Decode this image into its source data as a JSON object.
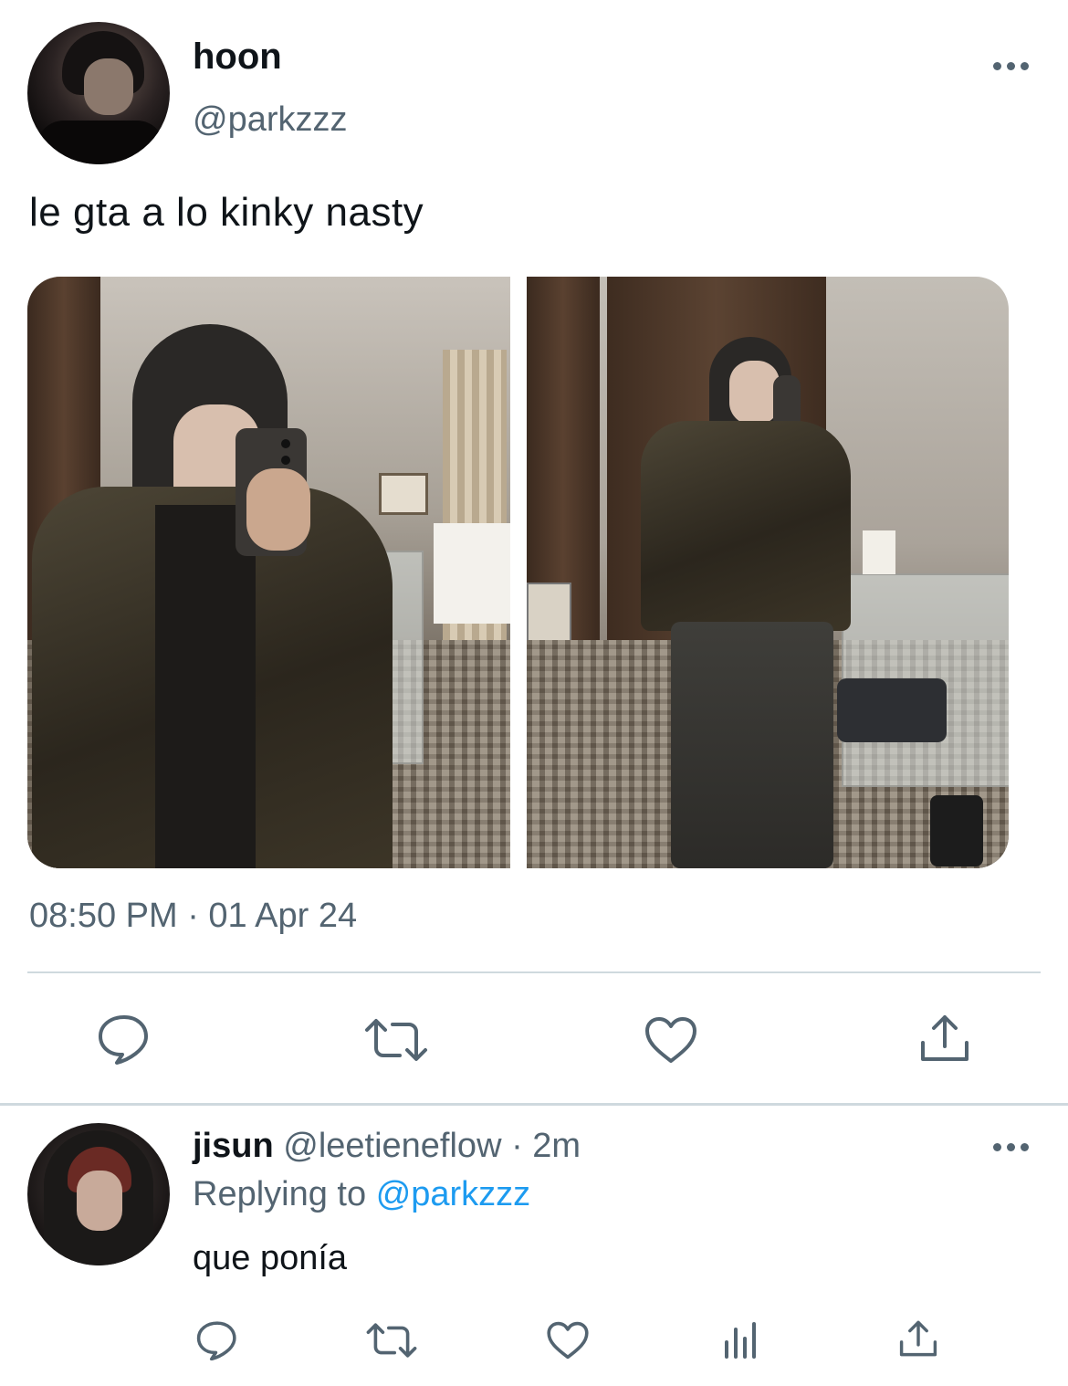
{
  "tweet": {
    "display_name": "hoon",
    "handle": "@parkzzz",
    "text": "le gta a lo kinky nasty",
    "timestamp": "08:50 PM · 01 Apr 24",
    "media_count": 2,
    "actions": [
      "reply-icon",
      "retweet-icon",
      "like-icon",
      "share-icon"
    ]
  },
  "reply": {
    "display_name": "jisun",
    "handle": "@leetieneflow",
    "separator": "·",
    "time_ago": "2m",
    "replying_prefix": "Replying to",
    "replying_to": "@parkzzz",
    "text": "que ponía",
    "actions": [
      "reply-icon",
      "retweet-icon",
      "like-icon",
      "views-icon",
      "share-icon"
    ]
  },
  "colors": {
    "text_primary": "#0f1419",
    "text_secondary": "#536471",
    "link": "#1d9bf0",
    "divider": "#cfd9de"
  }
}
